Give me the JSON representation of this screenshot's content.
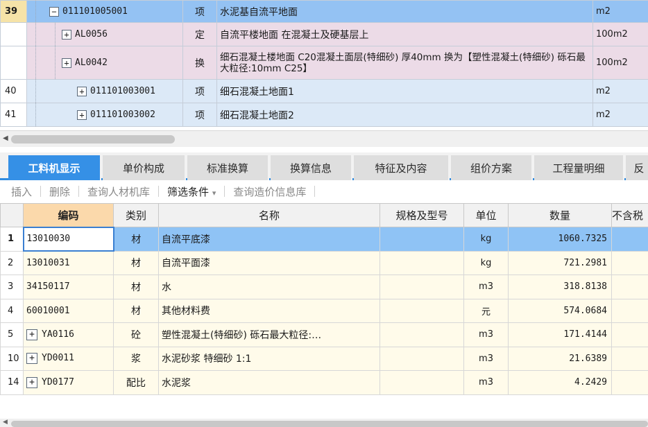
{
  "top_grid": {
    "rows": [
      {
        "num": "39",
        "code": "011101005001",
        "kind": "项",
        "name": "水泥基自流平地面",
        "unit": "m2"
      },
      {
        "num": "",
        "code": "AL0056",
        "kind": "定",
        "name": "自流平楼地面 在混凝土及硬基层上",
        "unit": "100m2"
      },
      {
        "num": "",
        "code": "AL0042",
        "kind": "换",
        "name": "细石混凝土楼地面 C20混凝土面层(特细砂) 厚40mm  换为【塑性混凝土(特细砂) 砾石最大粒径:10mm C25】",
        "unit": "100m2"
      },
      {
        "num": "40",
        "code": "011101003001",
        "kind": "项",
        "name": "细石混凝土地面1",
        "unit": "m2"
      },
      {
        "num": "41",
        "code": "011101003002",
        "kind": "项",
        "name": "细石混凝土地面2",
        "unit": "m2"
      }
    ],
    "expander_minus": "−",
    "expander_plus": "+"
  },
  "tabs": [
    {
      "label": "工料机显示",
      "active": true
    },
    {
      "label": "单价构成"
    },
    {
      "label": "标准换算"
    },
    {
      "label": "换算信息"
    },
    {
      "label": "特征及内容"
    },
    {
      "label": "组价方案"
    },
    {
      "label": "工程量明细"
    },
    {
      "label": "反"
    }
  ],
  "toolbar": {
    "insert": "插入",
    "delete": "删除",
    "query_library": "查询人材机库",
    "filter": "筛选条件",
    "filter_arrow": "▾",
    "query_price": "查询造价信息库"
  },
  "resource_grid": {
    "headers": {
      "code": "编码",
      "category": "类别",
      "name": "名称",
      "spec": "规格及型号",
      "unit": "单位",
      "quantity": "数量",
      "excl_tax": "不含税"
    },
    "rows": [
      {
        "num": "1",
        "code": "13010030",
        "category": "材",
        "name": "自流平底漆",
        "spec": "",
        "unit": "kg",
        "quantity": "1060.7325",
        "expandable": false
      },
      {
        "num": "2",
        "code": "13010031",
        "category": "材",
        "name": "自流平面漆",
        "spec": "",
        "unit": "kg",
        "quantity": "721.2981",
        "expandable": false
      },
      {
        "num": "3",
        "code": "34150117",
        "category": "材",
        "name": "水",
        "spec": "",
        "unit": "m3",
        "quantity": "318.8138",
        "expandable": false
      },
      {
        "num": "4",
        "code": "60010001",
        "category": "材",
        "name": "其他材料费",
        "spec": "",
        "unit": "元",
        "quantity": "574.0684",
        "expandable": false
      },
      {
        "num": "5",
        "code": "YA0116",
        "category": "砼",
        "name": "塑性混凝土(特细砂) 砾石最大粒径:…",
        "spec": "",
        "unit": "m3",
        "quantity": "171.4144",
        "expandable": true
      },
      {
        "num": "10",
        "code": "YD0011",
        "category": "浆",
        "name": "水泥砂浆 特细砂 1:1",
        "spec": "",
        "unit": "m3",
        "quantity": "21.6389",
        "expandable": true
      },
      {
        "num": "14",
        "code": "YD0177",
        "category": "配比",
        "name": "水泥浆",
        "spec": "",
        "unit": "m3",
        "quantity": "4.2429",
        "expandable": true
      }
    ]
  },
  "scrollbars": {
    "left_arrow": "◀"
  }
}
